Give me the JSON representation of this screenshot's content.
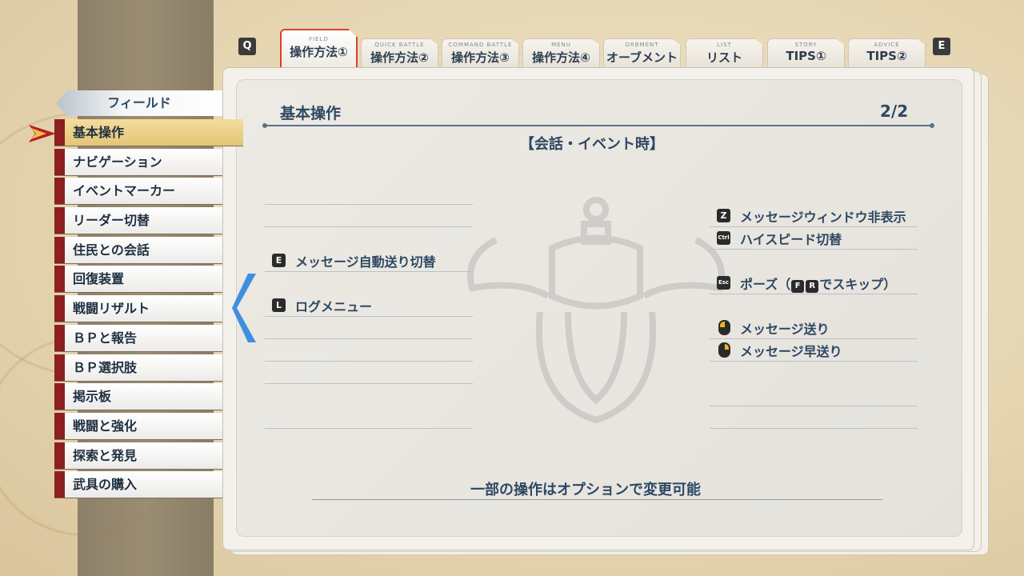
{
  "key_hints": {
    "prev": "Q",
    "next": "E"
  },
  "tabs": [
    {
      "sub": "FIELD",
      "label": "操作方法①"
    },
    {
      "sub": "QUICK BATTLE",
      "label": "操作方法②"
    },
    {
      "sub": "COMMAND BATTLE",
      "label": "操作方法③"
    },
    {
      "sub": "MENU",
      "label": "操作方法④"
    },
    {
      "sub": "ORBMENT",
      "label": "オーブメント"
    },
    {
      "sub": "LIST",
      "label": "リスト"
    },
    {
      "sub": "STORY",
      "label": "TIPS①"
    },
    {
      "sub": "ADVICE",
      "label": "TIPS②"
    }
  ],
  "sidebar": {
    "header": "フィールド",
    "items": [
      "基本操作",
      "ナビゲーション",
      "イベントマーカー",
      "リーダー切替",
      "住民との会話",
      "回復装置",
      "戦闘リザルト",
      "ＢＰと報告",
      "ＢＰ選択肢",
      "掲示板",
      "戦闘と強化",
      "探索と発見",
      "武具の購入"
    ]
  },
  "content": {
    "title": "基本操作",
    "page": "2/2",
    "section": "【会話・イベント時】",
    "left_commands": [
      {
        "key": "E",
        "text": "メッセージ自動送り切替"
      },
      {
        "key": "L",
        "text": "ログメニュー"
      }
    ],
    "right_commands": [
      {
        "key": "Z",
        "text": "メッセージウィンドウ非表示"
      },
      {
        "key": "Ctrl",
        "text": "ハイスピード切替"
      },
      {
        "key": "Esc",
        "text_prefix": "ポーズ（",
        "key2": "F",
        "key3": "R",
        "text_suffix": "でスキップ）"
      },
      {
        "icon": "mouse-left-click-icon",
        "text": "メッセージ送り"
      },
      {
        "icon": "mouse-right-click-icon",
        "text": "メッセージ早送り"
      }
    ],
    "footer": "一部の操作はオプションで変更可能"
  },
  "colors": {
    "accent": "#d9402c",
    "nav_marker": "#8c1f1f",
    "selected": "#e4c576",
    "text": "#2d4863"
  }
}
